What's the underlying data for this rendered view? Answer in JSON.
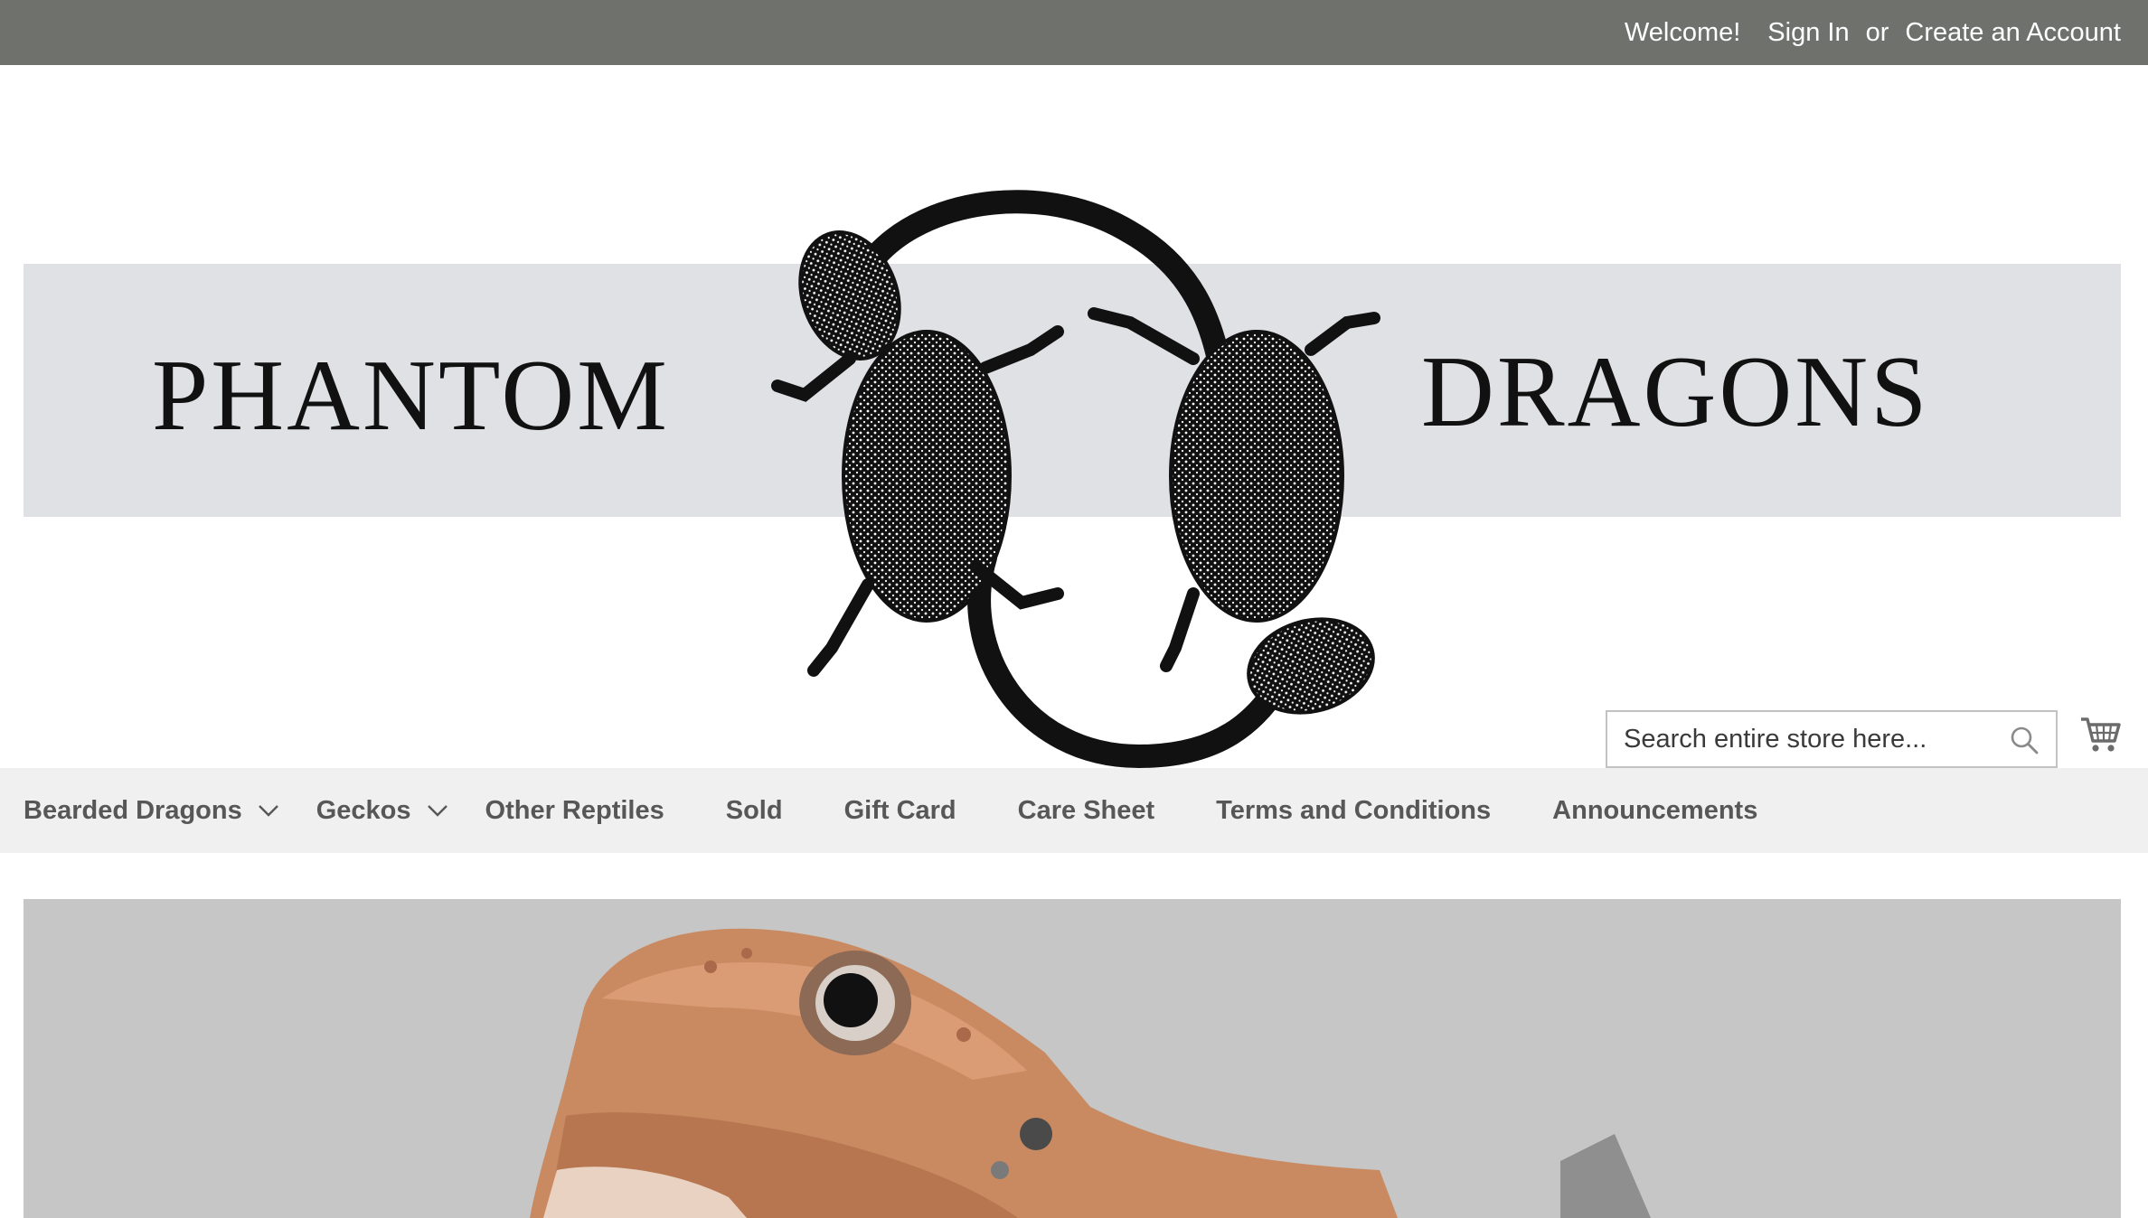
{
  "topbar": {
    "welcome": "Welcome!",
    "sign_in": "Sign In",
    "or": "or",
    "create_account": "Create an Account"
  },
  "logo": {
    "word_left": "PHANTOM",
    "word_right": "DRAGONS"
  },
  "search": {
    "placeholder": "Search entire store here...",
    "icon": "search-icon"
  },
  "cart": {
    "icon": "cart-icon"
  },
  "nav": {
    "items": [
      {
        "label": "Bearded Dragons",
        "has_dropdown": true
      },
      {
        "label": "Geckos",
        "has_dropdown": true
      },
      {
        "label": "Other Reptiles"
      },
      {
        "label": "Sold"
      },
      {
        "label": "Gift Card"
      },
      {
        "label": "Care Sheet"
      },
      {
        "label": "Terms and Conditions"
      },
      {
        "label": "Announcements"
      }
    ]
  },
  "colors": {
    "topbar_bg": "#6e716c",
    "logo_band": "#e0e1e5",
    "nav_bg": "#f0f0f0",
    "nav_text": "#575757",
    "hero_bg": "#c6c6c6",
    "lizard_orange": "#c98a62"
  }
}
